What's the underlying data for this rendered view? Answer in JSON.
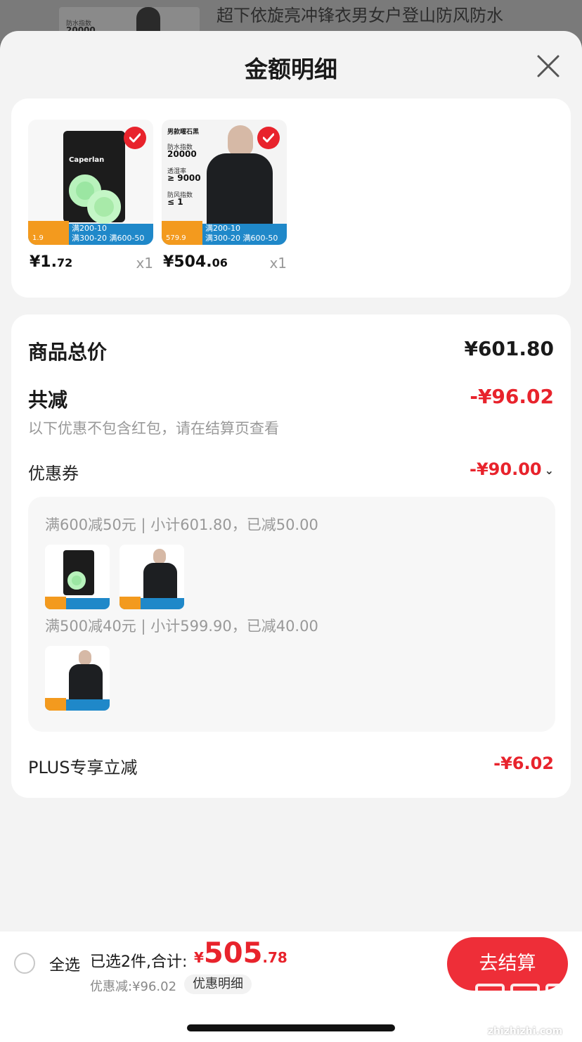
{
  "background": {
    "product_title": "超下依旋亮冲锋衣男女户登山防风防水",
    "thumb_label": "防水指数",
    "thumb_value": "20000"
  },
  "sheet": {
    "title": "金额明细",
    "close_icon": "close-icon"
  },
  "products": [
    {
      "check_icon": "checkmark-icon",
      "band_line1": "满200-10",
      "band_line2": "满300-20 满600-50",
      "band_price": "1.9",
      "pkg_brand": "Caperlan",
      "price_int": "¥1.",
      "price_dec": "72",
      "qty": "x1"
    },
    {
      "check_icon": "checkmark-icon",
      "band_line1": "满200-10",
      "band_line2": "满300-20 满600-50",
      "band_price": "579.9",
      "jk_title": "男款曜石黑",
      "jk_l1": "防水指数",
      "jk_v1": "20000",
      "jk_l2": "透湿率",
      "jk_v2": "≥ 9000",
      "jk_l3": "防风指数",
      "jk_v3": "≤ 1",
      "price_int": "¥504.",
      "price_dec": "06",
      "qty": "x1"
    }
  ],
  "summary": {
    "goods_total_label": "商品总价",
    "goods_total_value": "¥601.80",
    "total_discount_label": "共减",
    "total_discount_value": "-¥96.02",
    "note": "以下优惠不包含红包，请在结算页查看",
    "coupon_label": "优惠券",
    "coupon_value": "-¥90.00",
    "coupon_lines": [
      "满600减50元 | 小计601.80，已减50.00",
      "满500减40元 | 小计599.90，已减40.00"
    ],
    "plus_label": "PLUS专享立减",
    "plus_value": "-¥6.02"
  },
  "bottom": {
    "select_all": "全选",
    "selected_count": "已选2件,合计:",
    "total_currency": "¥",
    "total_int": "505",
    "total_dec": ".78",
    "discount": "优惠减:¥96.02",
    "detail_chip": "优惠明细",
    "checkout": "去结算"
  },
  "watermark": {
    "text": "zhizhizhi.com"
  },
  "colors": {
    "accent_red": "#e8232c",
    "checkout_red": "#ee2e38",
    "promo_blue": "#1f88c9",
    "promo_orange": "#f39a1e"
  }
}
